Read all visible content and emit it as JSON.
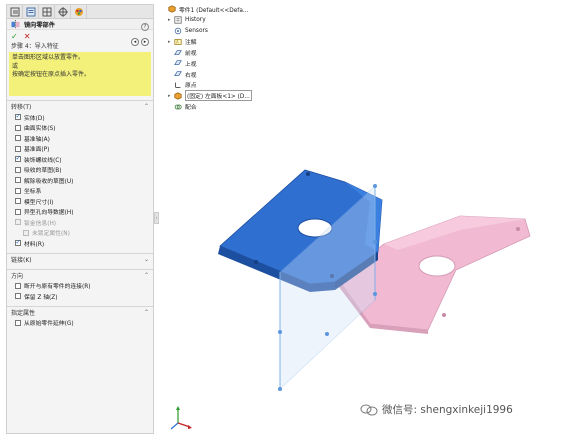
{
  "property_manager": {
    "title": "镜向零部件",
    "help": "?",
    "ok": "✓",
    "cancel": "✕",
    "nav_back": "◂",
    "nav_fwd": "▸",
    "step": "步骤 4：导入特征",
    "message": [
      "单击图形区域以放置零件。",
      "或",
      "按确定按钮在原点插入零件。"
    ],
    "transfer": {
      "label": "转移(T)",
      "items": [
        {
          "label": "实体(D)",
          "checked": true,
          "indent": false,
          "disabled": false
        },
        {
          "label": "曲面实体(S)",
          "checked": false,
          "indent": false,
          "disabled": false
        },
        {
          "label": "基准轴(A)",
          "checked": false,
          "indent": false,
          "disabled": false
        },
        {
          "label": "基准面(P)",
          "checked": false,
          "indent": false,
          "disabled": false
        },
        {
          "label": "装饰螺纹线(C)",
          "checked": true,
          "indent": false,
          "disabled": false
        },
        {
          "label": "吸收的草图(B)",
          "checked": false,
          "indent": false,
          "disabled": false
        },
        {
          "label": "解除吸收的草图(U)",
          "checked": false,
          "indent": false,
          "disabled": false
        },
        {
          "label": "坐标系",
          "checked": false,
          "indent": false,
          "disabled": false
        },
        {
          "label": "模型尺寸(I)",
          "checked": false,
          "indent": false,
          "disabled": false
        },
        {
          "label": "异型孔向导数据(H)",
          "checked": false,
          "indent": false,
          "disabled": false
        },
        {
          "label": "钣金信息(H)",
          "checked": false,
          "indent": false,
          "disabled": true
        },
        {
          "label": "未锁定属性(N)",
          "checked": false,
          "indent": true,
          "disabled": true
        },
        {
          "label": "材料(R)",
          "checked": true,
          "indent": false,
          "disabled": false
        }
      ]
    },
    "link": {
      "label": "链接(K)"
    },
    "direction": {
      "label": "方向",
      "items": [
        {
          "label": "断开与原有零件的连接(R)",
          "checked": false
        },
        {
          "label": "保留 Z 轴(Z)",
          "checked": false
        }
      ]
    },
    "propagate": {
      "label": "指定属性",
      "items": [
        {
          "label": "从原始零件延伸(G)",
          "checked": false
        }
      ]
    }
  },
  "feature_tree": {
    "root": "零件1 (Default<<Defa...",
    "items": [
      {
        "label": "History",
        "icon": "history-icon",
        "expander": "▸"
      },
      {
        "label": "Sensors",
        "icon": "sensor-icon",
        "expander": ""
      },
      {
        "label": "注解",
        "icon": "annotation-icon",
        "expander": "▸"
      },
      {
        "label": "前视",
        "icon": "plane-icon",
        "expander": ""
      },
      {
        "label": "上视",
        "icon": "plane-icon",
        "expander": ""
      },
      {
        "label": "右视",
        "icon": "plane-icon",
        "expander": ""
      },
      {
        "label": "原点",
        "icon": "origin-icon",
        "expander": ""
      },
      {
        "label": "(固定) 左面板<1> (D...",
        "icon": "part-icon",
        "expander": "▸",
        "selected": true
      },
      {
        "label": "配合",
        "icon": "mate-icon",
        "expander": ""
      }
    ]
  },
  "watermark": "微信号: shengxinkeji1996",
  "colors": {
    "part_blue": "#2f6fd0",
    "part_pink": "#f2b9d2",
    "highlight_yellow": "#f3f17a",
    "ok_green": "#2a9d2a",
    "cancel_red": "#c42020"
  }
}
